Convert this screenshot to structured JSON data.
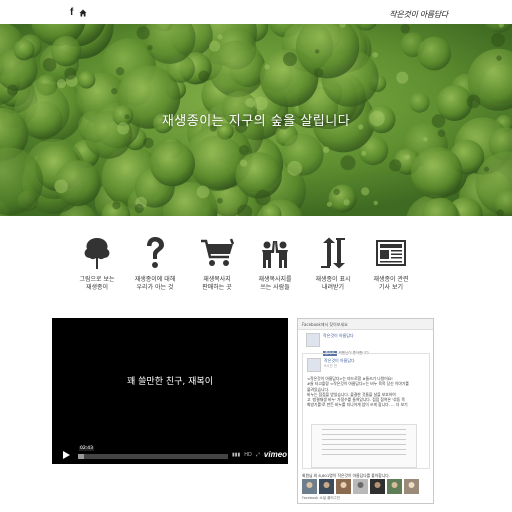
{
  "header": {
    "facebook_icon": "facebook-icon",
    "home_icon": "home-icon",
    "logo_text": "작은것이 아름답다"
  },
  "hero": {
    "tagline": "재생종이는 지구의 숲을 살립니다"
  },
  "features": [
    {
      "icon": "tree-icon",
      "line1": "그림으로 보는",
      "line2": "재생종이"
    },
    {
      "icon": "question-icon",
      "line1": "재생종이에 대해",
      "line2": "우리가 아는 것"
    },
    {
      "icon": "cart-icon",
      "line1": "재생복사지",
      "line2": "판매하는 곳"
    },
    {
      "icon": "people-icon",
      "line1": "재생복사지를",
      "line2": "쓰는 사람들"
    },
    {
      "icon": "recycle-arrows-icon",
      "line1": "재생종이 표시",
      "line2": "내려받기"
    },
    {
      "icon": "newspaper-icon",
      "line1": "재생종이 관련",
      "line2": "기사 보기"
    }
  ],
  "video": {
    "title": "꽤 쓸만한 친구, 재복이",
    "timecode": "02:43",
    "hd_label": "HD",
    "brand": "vimeo",
    "progress": 0.04
  },
  "facebook_widget": {
    "header": "Facebook에서 찾아보세요",
    "page_name": "작은것이 아름답다",
    "like_label": "좋아요",
    "like_count": "회원님이 좋아합니다.",
    "post_name": "작은것이 아름답다",
    "post_time": "9시간 전",
    "post_lines": [
      "<작은것이 아름답다>는 마드로함 #들쓰기 나왔어요!",
      "#들 타고몰랑 <작은것이 아름답다>는 비누 육목 당신 이야기를",
      "물려있습니다.",
      "비누는 점점을 받았습니다. 물결한 것들을 살을 보호하여",
      "고 '방결재생 비누' 가정수를 들여있니다. 점점 참여온 '섞둥 목",
      "화방기를'로 만든 비누를 지니어게 엄이 쓰게 합니다. ... 더 보기"
    ],
    "fans_text": "회원님 외 8,601명이 작은것이 아름답다를 좋아합니다.",
    "footer": "Facebook 소셜 플러그인"
  },
  "colors": {
    "hero_green": "#5b8a2e",
    "video_bg": "#000000",
    "facebook_blue": "#3b5998"
  }
}
